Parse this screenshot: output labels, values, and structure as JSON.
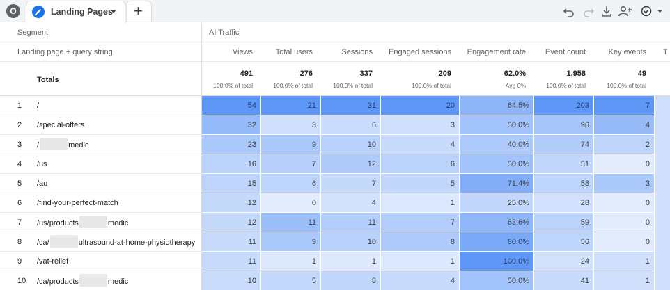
{
  "app": {
    "avatar_letter": "O",
    "tab_label": "Landing Pages",
    "add_tab": "+"
  },
  "toolbar": {
    "icons": [
      "undo-icon",
      "redo-icon",
      "download-icon",
      "share-icon",
      "status-check-icon"
    ]
  },
  "table": {
    "segment_label": "Segment",
    "dimension_label": "Landing page + query string",
    "segment_name": "AI Traffic",
    "totals_label": "Totals",
    "extra_column_letter": "T",
    "columns": [
      "Views",
      "Total users",
      "Sessions",
      "Engaged sessions",
      "Engagement rate",
      "Event count",
      "Key events"
    ],
    "totals": [
      {
        "value": "491",
        "sub": "100.0% of total"
      },
      {
        "value": "276",
        "sub": "100.0% of total"
      },
      {
        "value": "337",
        "sub": "100.0% of total"
      },
      {
        "value": "209",
        "sub": "100.0% of total"
      },
      {
        "value": "62.0%",
        "sub": "Avg 0%"
      },
      {
        "value": "1,958",
        "sub": "100.0% of total"
      },
      {
        "value": "49",
        "sub": "100.0% of total"
      }
    ],
    "rows": [
      {
        "idx": "1",
        "page": [
          "/"
        ],
        "values": [
          "54",
          "21",
          "31",
          "20",
          "64.5%",
          "203",
          "7"
        ]
      },
      {
        "idx": "2",
        "page": [
          "/special-offers"
        ],
        "values": [
          "32",
          "3",
          "6",
          "3",
          "50.0%",
          "96",
          "4"
        ]
      },
      {
        "idx": "3",
        "page": [
          "/",
          "medic"
        ],
        "values": [
          "23",
          "9",
          "10",
          "4",
          "40.0%",
          "74",
          "2"
        ]
      },
      {
        "idx": "4",
        "page": [
          "/us"
        ],
        "values": [
          "16",
          "7",
          "12",
          "6",
          "50.0%",
          "51",
          "0"
        ]
      },
      {
        "idx": "5",
        "page": [
          "/au"
        ],
        "values": [
          "15",
          "6",
          "7",
          "5",
          "71.4%",
          "58",
          "3"
        ]
      },
      {
        "idx": "6",
        "page": [
          "/find-your-perfect-match"
        ],
        "values": [
          "12",
          "0",
          "4",
          "1",
          "25.0%",
          "28",
          "0"
        ]
      },
      {
        "idx": "7",
        "page": [
          "/us/products",
          "medic"
        ],
        "values": [
          "12",
          "11",
          "11",
          "7",
          "63.6%",
          "59",
          "0"
        ]
      },
      {
        "idx": "8",
        "page": [
          "/ca/",
          "ultrasound-at-home-physiotherapy"
        ],
        "values": [
          "11",
          "9",
          "10",
          "8",
          "80.0%",
          "56",
          "0"
        ]
      },
      {
        "idx": "9",
        "page": [
          "/vat-relief"
        ],
        "values": [
          "11",
          "1",
          "1",
          "1",
          "100.0%",
          "24",
          "1"
        ]
      },
      {
        "idx": "10",
        "page": [
          "/ca/products",
          "medic"
        ],
        "values": [
          "10",
          "5",
          "8",
          "4",
          "50.0%",
          "41",
          "1"
        ]
      }
    ]
  },
  "colors": {
    "heat_low": "#e3ecfd",
    "heat_high": "#5e97f6",
    "accent": "#1a73e8"
  }
}
